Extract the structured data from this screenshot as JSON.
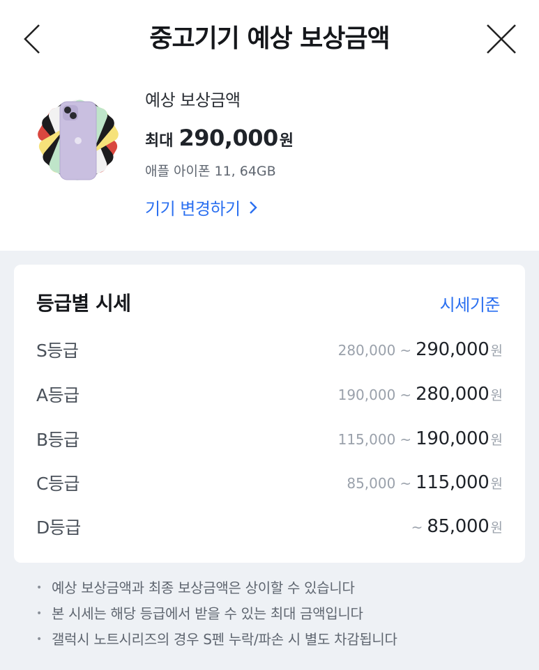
{
  "header": {
    "title": "중고기기 예상 보상금액",
    "back_icon": "chevron-left-icon",
    "close_icon": "close-icon"
  },
  "product": {
    "label": "예상 보상금액",
    "price_prefix": "최대",
    "price_value": "290,000",
    "price_unit": "원",
    "device_name": "애플 아이폰 11, 64GB",
    "change_label": "기기 변경하기"
  },
  "grades": {
    "title": "등급별 시세",
    "criteria_label": "시세기준",
    "tilde": "~",
    "unit": "원",
    "rows": [
      {
        "label": "S등급",
        "min": "280,000",
        "max": "290,000"
      },
      {
        "label": "A등급",
        "min": "190,000",
        "max": "280,000"
      },
      {
        "label": "B등급",
        "min": "115,000",
        "max": "190,000"
      },
      {
        "label": "C등급",
        "min": "85,000",
        "max": "115,000"
      },
      {
        "label": "D등급",
        "min": "",
        "max": "85,000"
      }
    ]
  },
  "notes": [
    "예상 보상금액과 최종 보상금액은 상이할 수 있습니다",
    "본 시세는 해당 등급에서 받을 수 있는 최대 금액입니다",
    "갤럭시 노트시리즈의 경우 S펜 누락/파손 시 별도 차감됩니다"
  ],
  "colors": {
    "accent": "#2a6ff0",
    "background": "#eef1f5",
    "phone_purple": "#c9bfe0"
  }
}
